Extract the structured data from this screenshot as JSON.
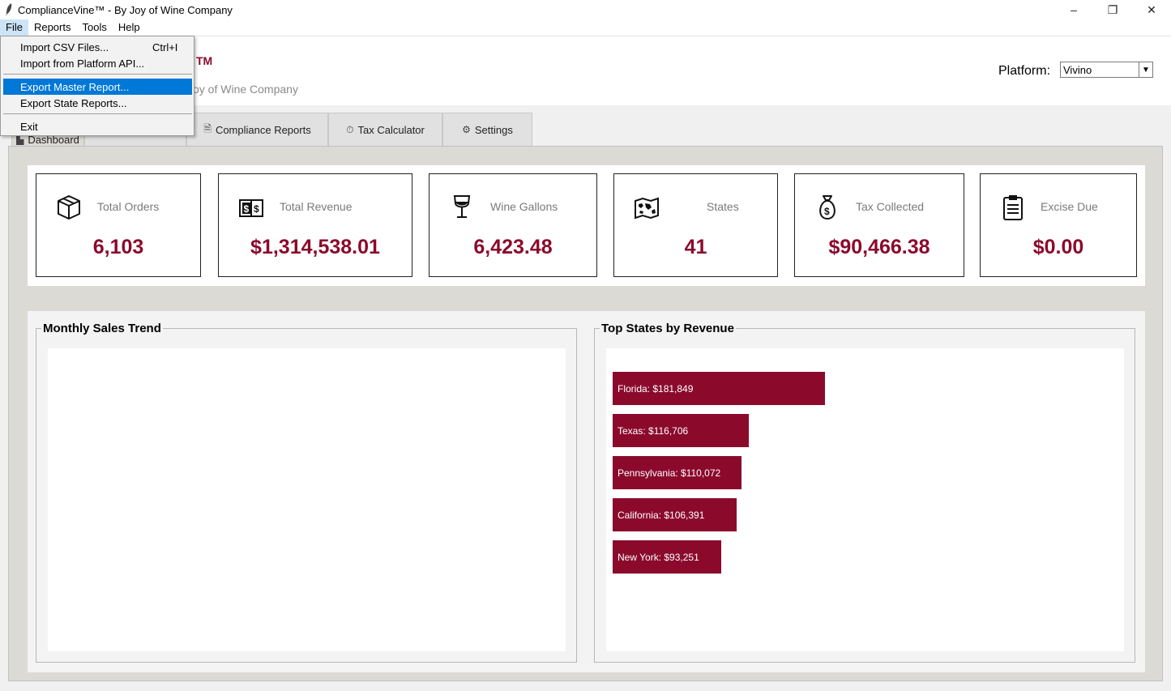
{
  "window": {
    "title": "ComplianceVine™ - By Joy of Wine Company",
    "controls": {
      "minimize": "–",
      "restore": "❐",
      "close": "✕"
    }
  },
  "menubar": [
    "File",
    "Reports",
    "Tools",
    "Help"
  ],
  "file_menu": {
    "items": [
      {
        "label": "Import CSV Files...",
        "shortcut": "Ctrl+I"
      },
      {
        "label": "Import from Platform API..."
      },
      {
        "label": "Export Master Report...",
        "highlighted": true
      },
      {
        "label": "Export State Reports..."
      },
      {
        "label": "Exit"
      }
    ]
  },
  "header": {
    "brand_tm": "TM",
    "brand_sub_partial": "oy of Wine Company",
    "platform_label": "Platform:",
    "platform_value": "Vivino"
  },
  "tabs": [
    {
      "label": "Dashboard",
      "icon": "chart-icon",
      "selected": true
    },
    {
      "label": "Compliance Reports",
      "icon": "report-icon"
    },
    {
      "label": "Tax Calculator",
      "icon": "stopwatch-icon"
    },
    {
      "label": "Settings",
      "icon": "gear-icon"
    }
  ],
  "metrics": [
    {
      "label": "Total Orders",
      "value": "6,103",
      "icon": "box-icon"
    },
    {
      "label": "Total Revenue",
      "value": "$1,314,538.01",
      "icon": "money-icon"
    },
    {
      "label": "Wine Gallons",
      "value": "6,423.48",
      "icon": "wine-glass-icon"
    },
    {
      "label": "States",
      "value": "41",
      "icon": "map-icon"
    },
    {
      "label": "Tax Collected",
      "value": "$90,466.38",
      "icon": "money-bag-icon"
    },
    {
      "label": "Excise Due",
      "value": "$0.00",
      "icon": "clipboard-icon"
    }
  ],
  "panels": {
    "monthly_title": "Monthly Sales Trend",
    "states_title": "Top States by Revenue"
  },
  "chart_data": {
    "type": "bar",
    "orientation": "horizontal",
    "title": "Top States by Revenue",
    "categories": [
      "Florida",
      "Texas",
      "Pennsylvania",
      "California",
      "New York"
    ],
    "values": [
      181849,
      116706,
      110072,
      106391,
      93251
    ],
    "labels": [
      "Florida: $181,849",
      "Texas: $116,706",
      "Pennsylvania: $110,072",
      "California: $106,391",
      "New York: $93,251"
    ],
    "color": "#8b0a2c"
  },
  "colors": {
    "accent": "#8b0a2c",
    "highlight": "#0078d7"
  }
}
